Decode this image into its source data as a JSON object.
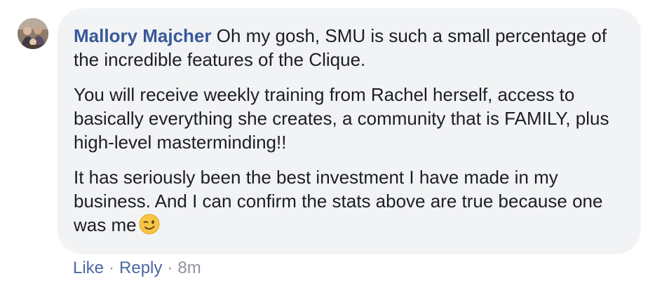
{
  "comment": {
    "author": "Mallory Majcher",
    "paragraphs": [
      "Oh my gosh, SMU is such a small percentage of the incredible features of the Clique.",
      "You will receive weekly training from Rachel herself, access to basically everything she creates, a community that is FAMILY, plus high-level masterminding!!",
      "It has seriously been the best investment I have made in my business. And I can confirm the stats above are true because one was me"
    ],
    "emoji": "winking-face-emoji"
  },
  "actions": {
    "like_label": "Like",
    "reply_label": "Reply",
    "separator": "·",
    "timestamp": "8m"
  }
}
